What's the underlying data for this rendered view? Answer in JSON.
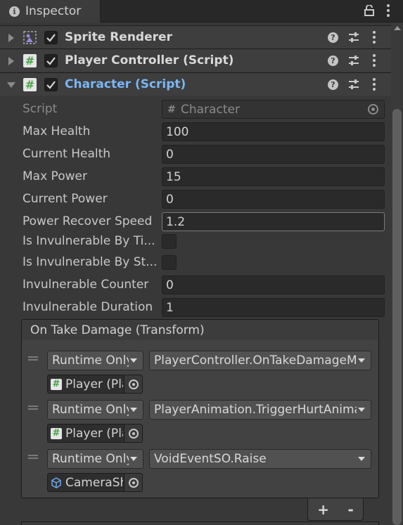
{
  "tab": {
    "icon": "info-icon",
    "label": "Inspector"
  },
  "components": [
    {
      "title": "Sprite Renderer",
      "icon": "sprite-renderer-icon",
      "enabled": true,
      "expanded": false
    },
    {
      "title": "Player Controller (Script)",
      "icon": "script-icon",
      "enabled": true,
      "expanded": false
    },
    {
      "title": "Character (Script)",
      "icon": "script-icon",
      "enabled": true,
      "expanded": true
    }
  ],
  "fields": {
    "script": {
      "label": "Script",
      "value": "Character"
    },
    "max_health": {
      "label": "Max Health",
      "value": "100"
    },
    "current_health": {
      "label": "Current Health",
      "value": "0"
    },
    "max_power": {
      "label": "Max Power",
      "value": "15"
    },
    "current_power": {
      "label": "Current Power",
      "value": "0"
    },
    "power_recover_speed": {
      "label": "Power Recover Speed",
      "value": "1.2"
    },
    "invul_by_ti": {
      "label": "Is Invulnerable By Ti...",
      "checked": false
    },
    "invul_by_st": {
      "label": "Is Invulnerable By St...",
      "checked": false
    },
    "invul_counter": {
      "label": "Invulnerable Counter",
      "value": "0"
    },
    "invul_duration": {
      "label": "Invulnerable Duration",
      "value": "1"
    }
  },
  "event": {
    "title": "On Take Damage (Transform)",
    "listeners": [
      {
        "mode": "Runtime Only",
        "function": "PlayerController.OnTakeDamageMotion",
        "target": "Player (Player",
        "target_icon": "script-icon"
      },
      {
        "mode": "Runtime Only",
        "function": "PlayerAnimation.TriggerHurtAnimation",
        "target": "Player (Player",
        "target_icon": "script-icon"
      },
      {
        "mode": "Runtime Only",
        "function": "VoidEventSO.Raise",
        "target": "CameraShake",
        "target_icon": "scriptable-object-icon"
      }
    ],
    "add_label": "+",
    "remove_label": "-"
  }
}
